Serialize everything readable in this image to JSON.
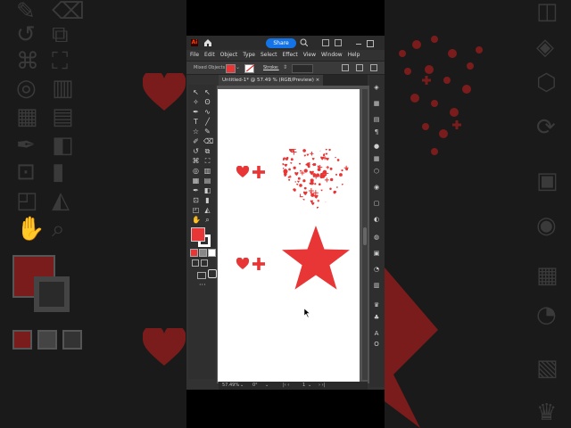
{
  "app": {
    "logo": "Ai",
    "share_label": "Share",
    "menus": [
      "File",
      "Edit",
      "Object",
      "Type",
      "Select",
      "Effect",
      "View",
      "Window",
      "Help"
    ],
    "control": {
      "mixed_objects_label": "Mixed Objects",
      "stroke_label": "Stroke:"
    },
    "document_tab": "Untitled-1* @ 57.49 % (RGB/Preview)",
    "zoom": "57.49%",
    "rotation": "0°",
    "artboard_index": "1"
  },
  "colors": {
    "accent": "#1473e6",
    "fill": "#e83535",
    "app_bg": "#323232"
  },
  "icons": [
    "home-icon",
    "search-icon",
    "arrange-icon",
    "panels-icon",
    "heart-icon",
    "plus-icon",
    "star-icon",
    "cursor-icon"
  ]
}
